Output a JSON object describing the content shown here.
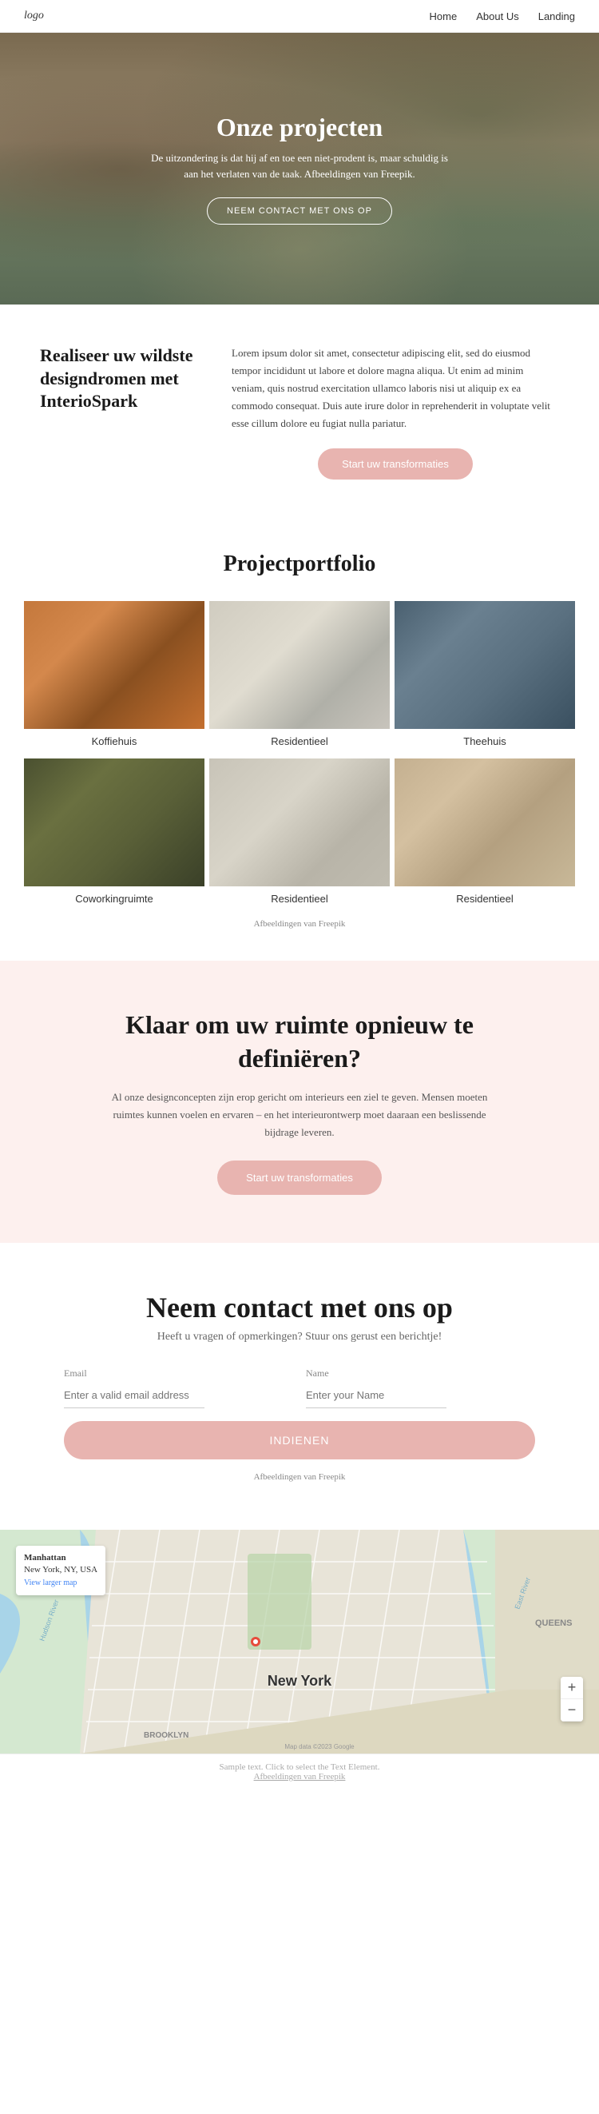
{
  "nav": {
    "logo": "logo",
    "links": [
      {
        "label": "Home",
        "href": "#"
      },
      {
        "label": "About Us",
        "href": "#"
      },
      {
        "label": "Landing",
        "href": "#"
      }
    ]
  },
  "hero": {
    "title": "Onze projecten",
    "description": "De uitzondering is dat hij af en toe een niet-prodent is, maar schuldig is aan het verlaten van de taak. Afbeeldingen van Freepik.",
    "freepik_link_text": "Freepik",
    "cta_button": "NEEM CONTACT MET ONS OP"
  },
  "about": {
    "heading": "Realiseer uw wildste designdromen met InterioSpark",
    "body": "Lorem ipsum dolor sit amet, consectetur adipiscing elit, sed do eiusmod tempor incididunt ut labore et dolore magna aliqua. Ut enim ad minim veniam, quis nostrud exercitation ullamco laboris nisi ut aliquip ex ea commodo consequat. Duis aute irure dolor in reprehenderit in voluptate velit esse cillum dolore eu fugiat nulla pariatur.",
    "button": "Start uw transformaties"
  },
  "portfolio": {
    "title": "Projectportfolio",
    "items": [
      {
        "label": "Koffiehuis",
        "img_class": "img-coffeehouse"
      },
      {
        "label": "Residentieel",
        "img_class": "img-residential1"
      },
      {
        "label": "Theehuis",
        "img_class": "img-teahouse"
      },
      {
        "label": "Coworkingruimte",
        "img_class": "img-coworking"
      },
      {
        "label": "Residentieel",
        "img_class": "img-residential2"
      },
      {
        "label": "Residentieel",
        "img_class": "img-residential3"
      }
    ],
    "credits": "Afbeeldingen van Freepik"
  },
  "cta": {
    "title": "Klaar om uw ruimte opnieuw te definiëren?",
    "description": "Al onze designconcepten zijn erop gericht om interieurs een ziel te geven. Mensen moeten ruimtes kunnen voelen en ervaren – en het interieurontwerp moet daaraan een beslissende bijdrage leveren.",
    "button": "Start uw transformaties"
  },
  "contact": {
    "title": "Neem contact met ons op",
    "subtitle": "Heeft u vragen of opmerkingen? Stuur ons gerust een berichtje!",
    "email_label": "Email",
    "email_placeholder": "Enter a valid email address",
    "name_label": "Name",
    "name_placeholder": "Enter your Name",
    "submit_button": "INDIENEN",
    "credits": "Afbeeldingen van Freepik"
  },
  "map": {
    "location_name": "Manhattan",
    "location_address": "New York, NY, USA",
    "view_larger_link": "View larger map",
    "city_label": "New York",
    "zoom_in": "+",
    "zoom_out": "−"
  },
  "footer_bar": {
    "sample_text": "Sample text. Click to select the Text Element.",
    "credits_text": "Afbeeldingen van Freepik"
  }
}
